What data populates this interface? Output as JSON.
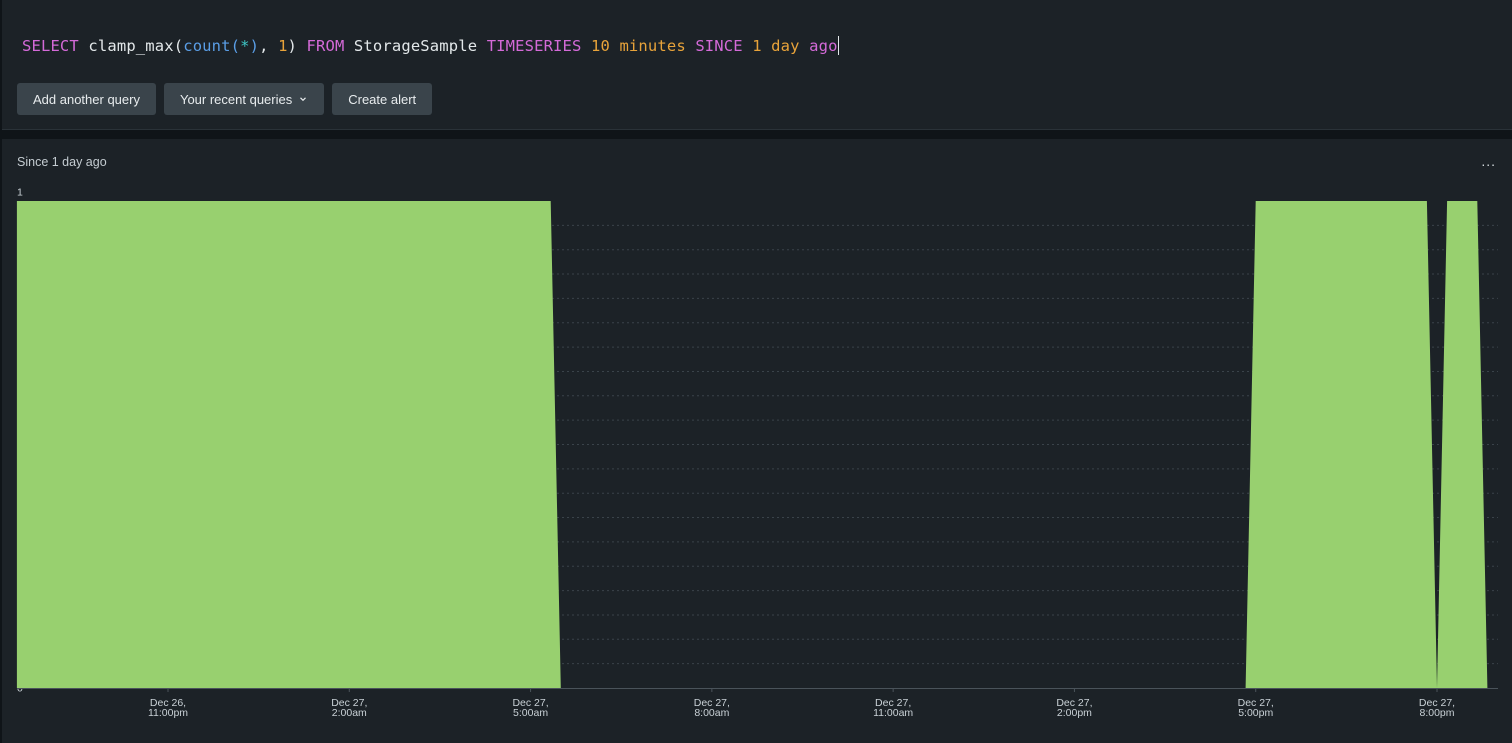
{
  "query": {
    "tokens": [
      {
        "text": "SELECT",
        "kind": "keyword"
      },
      {
        "text": " clamp_max(",
        "kind": "plain"
      },
      {
        "text": "count",
        "kind": "func"
      },
      {
        "text": "(",
        "kind": "func"
      },
      {
        "text": "*",
        "kind": "star"
      },
      {
        "text": ")",
        "kind": "func"
      },
      {
        "text": ", ",
        "kind": "plain"
      },
      {
        "text": "1",
        "kind": "num"
      },
      {
        "text": ") ",
        "kind": "plain"
      },
      {
        "text": "FROM",
        "kind": "keyword"
      },
      {
        "text": " StorageSample ",
        "kind": "plain"
      },
      {
        "text": "TIMESERIES",
        "kind": "keyword"
      },
      {
        "text": " ",
        "kind": "plain"
      },
      {
        "text": "10 minutes",
        "kind": "num"
      },
      {
        "text": " ",
        "kind": "plain"
      },
      {
        "text": "SINCE",
        "kind": "keyword"
      },
      {
        "text": " ",
        "kind": "plain"
      },
      {
        "text": "1 day",
        "kind": "num"
      },
      {
        "text": " ",
        "kind": "plain"
      },
      {
        "text": "ago",
        "kind": "keyword"
      }
    ]
  },
  "toolbar": {
    "add_query_label": "Add another query",
    "recent_queries_label": "Your recent queries",
    "create_alert_label": "Create alert"
  },
  "chart_panel": {
    "title": "Since 1 day ago",
    "more_label": "..."
  },
  "colors": {
    "area_fill": "#98d06f",
    "grid": "#3a434a",
    "keyword": "#d46ad8",
    "function": "#5a9ee6",
    "number": "#e8a33a"
  },
  "chart_data": {
    "type": "area",
    "title": "",
    "xlabel": "",
    "ylabel": "",
    "ylim": [
      0,
      1
    ],
    "y_ticks": [
      "0",
      "0.05",
      "0.1",
      "0.15",
      "0.2",
      "0.25",
      "0.3",
      "0.35",
      "0.4",
      "0.45",
      "0.5",
      "0.55",
      "0.6",
      "0.65",
      "0.7",
      "0.75",
      "0.8",
      "0.85",
      "0.9",
      "0.95",
      "1"
    ],
    "x_ticks": [
      {
        "time": "Dec 26 11:00pm",
        "line1": "Dec 26,",
        "line2": "11:00pm"
      },
      {
        "time": "Dec 27 2:00am",
        "line1": "Dec 27,",
        "line2": "2:00am"
      },
      {
        "time": "Dec 27 5:00am",
        "line1": "Dec 27,",
        "line2": "5:00am"
      },
      {
        "time": "Dec 27 8:00am",
        "line1": "Dec 27,",
        "line2": "8:00am"
      },
      {
        "time": "Dec 27 11:00am",
        "line1": "Dec 27,",
        "line2": "11:00am"
      },
      {
        "time": "Dec 27 2:00pm",
        "line1": "Dec 27,",
        "line2": "2:00pm"
      },
      {
        "time": "Dec 27 5:00pm",
        "line1": "Dec 27,",
        "line2": "5:00pm"
      },
      {
        "time": "Dec 27 8:00pm",
        "line1": "Dec 27,",
        "line2": "8:00pm"
      }
    ],
    "grid": true,
    "x_range": [
      "Dec 26 8:30pm",
      "Dec 27 8:50pm"
    ],
    "series": [
      {
        "points": [
          {
            "x": "Dec 26 8:30pm",
            "y": 0
          },
          {
            "x": "Dec 26 8:30pm",
            "y": 1
          },
          {
            "x": "Dec 27 5:20am",
            "y": 1
          },
          {
            "x": "Dec 27 5:30am",
            "y": 0
          },
          {
            "x": "Dec 27 4:50pm",
            "y": 0
          },
          {
            "x": "Dec 27 5:00pm",
            "y": 1
          },
          {
            "x": "Dec 27 7:50pm",
            "y": 1
          },
          {
            "x": "Dec 27 8:00pm",
            "y": 0
          },
          {
            "x": "Dec 27 8:10pm",
            "y": 1
          },
          {
            "x": "Dec 27 8:40pm",
            "y": 1
          },
          {
            "x": "Dec 27 8:50pm",
            "y": 0
          }
        ]
      }
    ]
  }
}
